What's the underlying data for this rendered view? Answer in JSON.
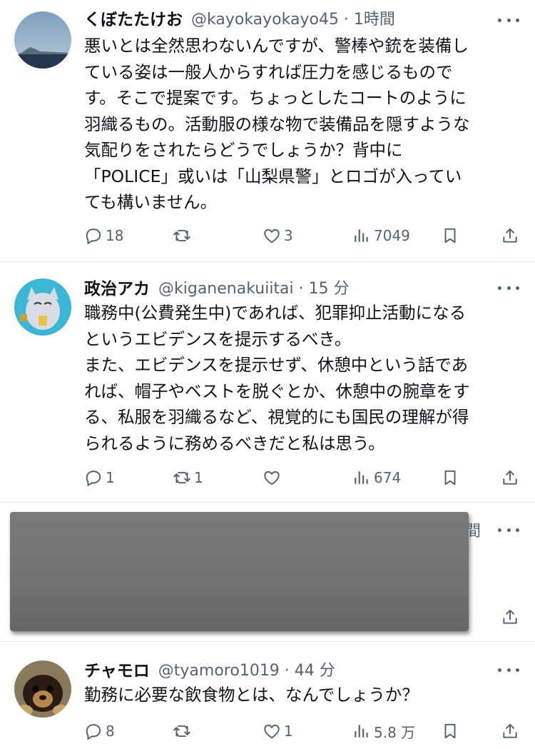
{
  "tweets": [
    {
      "name": "くぼたたけお",
      "handle": "@kayokayokayo45 · 1時間",
      "text": "悪いとは全然思わないんですが、警棒や銃を装備し\nている姿は一般人からすれば圧力を感じるものmで\nす。そこで提案です。ちょっとしたコートのように\n羽織るもの。活動服の様な物で装備品を隠すような\n気配りをされたらどうでしょうか？背中に\n「POLICE」或いは「山梨県警」とロゴが入ってい\nても構いません。",
      "replies": "18",
      "retweets": "",
      "likes": "3",
      "views": "7049"
    },
    {
      "name": "政治アカ",
      "handle": "@kiganenakuiitai · 15 分",
      "text": "職務中(公費発生中)であれば、犯罪抑止活動になる\nというエビデンスを提示するべき。\nまた、エビデンスを提示せず、休憩中という話であ\nれば、帽子やベストを脱ぐとか、休憩中の腕章をす\nる、私服を羽織るなど、視覚的にも国民の理解が得\nられるように務めるべきだと私は思う。",
      "replies": "1",
      "retweets": "1",
      "likes": "",
      "views": "674"
    },
    {
      "visible_fragment": "間"
    },
    {
      "name": "チャモロ",
      "handle": "@tyamoro1019 · 44 分",
      "text": "勤務に必要な飲食物とは、なんでしょうか？",
      "replies": "8",
      "retweets": "",
      "likes": "1",
      "views": "5.8 万"
    }
  ],
  "colors": {
    "text": "#0f1419",
    "muted": "#536471",
    "divider": "#e6e9eb"
  },
  "icons": [
    "reply-icon",
    "retweet-icon",
    "like-icon",
    "views-icon",
    "bookmark-icon",
    "share-icon",
    "more-icon"
  ]
}
